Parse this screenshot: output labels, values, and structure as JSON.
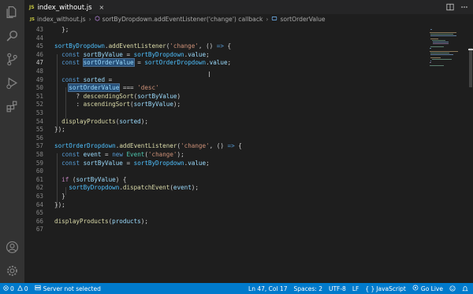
{
  "tab": {
    "badge": "JS",
    "filename": "index_without.js",
    "close": "×"
  },
  "breadcrumb": {
    "badge": "JS",
    "file": "index_without.js",
    "symbol1": "sortByDropdown.addEventListener('change') callback",
    "symbol2": "sortOrderValue",
    "sep": "›"
  },
  "code_lines": [
    {
      "n": "43",
      "code": "  };"
    },
    {
      "n": "44",
      "code": ""
    },
    {
      "n": "45",
      "code": "sortByDropdown.addEventListener('change', () => {"
    },
    {
      "n": "46",
      "code": "  const sortByValue = sortByDropdown.value;"
    },
    {
      "n": "47",
      "code": "  const sortOrderValue = sortOrderDropdown.value;"
    },
    {
      "n": "48",
      "code": ""
    },
    {
      "n": "49",
      "code": "  const sorted ="
    },
    {
      "n": "50",
      "code": "    sortOrderValue === 'desc'"
    },
    {
      "n": "51",
      "code": "      ? descendingSort(sortByValue)"
    },
    {
      "n": "52",
      "code": "      : ascendingSort(sortByValue);"
    },
    {
      "n": "53",
      "code": ""
    },
    {
      "n": "54",
      "code": "  displayProducts(sorted);"
    },
    {
      "n": "55",
      "code": "});"
    },
    {
      "n": "56",
      "code": ""
    },
    {
      "n": "57",
      "code": "sortOrderDropdown.addEventListener('change', () => {"
    },
    {
      "n": "58",
      "code": "  const event = new Event('change');"
    },
    {
      "n": "59",
      "code": "  const sortByValue = sortByDropdown.value;"
    },
    {
      "n": "60",
      "code": ""
    },
    {
      "n": "61",
      "code": "  if (sortByValue) {"
    },
    {
      "n": "62",
      "code": "    sortByDropdown.dispatchEvent(event);"
    },
    {
      "n": "63",
      "code": "  }"
    },
    {
      "n": "64",
      "code": "});"
    },
    {
      "n": "65",
      "code": ""
    },
    {
      "n": "66",
      "code": "displayProducts(products);"
    },
    {
      "n": "67",
      "code": ""
    }
  ],
  "status": {
    "errors": "0",
    "warnings": "0",
    "server": "Server not selected",
    "position": "Ln 47, Col 17",
    "spaces": "Spaces: 2",
    "encoding": "UTF-8",
    "eol": "LF",
    "language": "JavaScript",
    "golive": "Go Live"
  },
  "activity_icons": [
    "files-icon",
    "search-icon",
    "source-control-icon",
    "run-debug-icon",
    "extensions-icon",
    "account-icon",
    "settings-gear-icon"
  ],
  "colors": {
    "statusbar": "#007acc",
    "activitybar": "#333333",
    "editor": "#1e1e1e"
  }
}
